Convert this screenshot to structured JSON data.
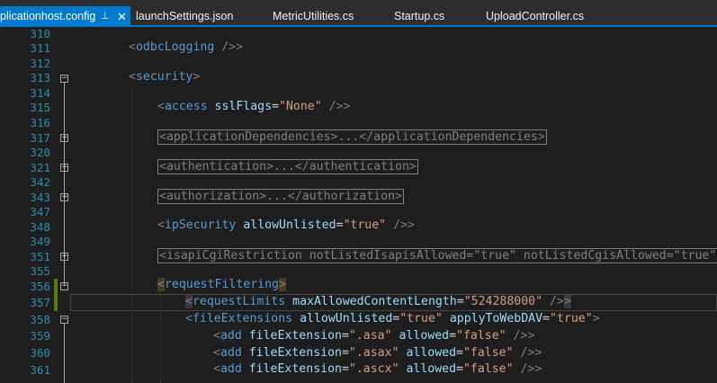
{
  "tabs": [
    {
      "label": "plicationhost.config",
      "pin": "⊥",
      "close": "✕",
      "active": true
    },
    {
      "label": "launchSettings.json"
    },
    {
      "label": "MetricUtilities.cs"
    },
    {
      "label": "Startup.cs"
    },
    {
      "label": "UploadController.cs"
    }
  ],
  "lines": [
    {
      "num": "310"
    },
    {
      "num": "311",
      "tag": "odbcLogging",
      "close": " />"
    },
    {
      "num": "312"
    },
    {
      "num": "313",
      "tag": "security",
      "fold": "−"
    },
    {
      "num": "314"
    },
    {
      "num": "315",
      "tag": "access",
      "attr1": "sslFlags",
      "val1": "\"None\"",
      "close": " />"
    },
    {
      "num": "316"
    },
    {
      "num": "317",
      "collapsed": "<applicationDependencies>...</applicationDependencies>",
      "fold": "+"
    },
    {
      "num": "320"
    },
    {
      "num": "321",
      "collapsed": "<authentication>...</authentication>",
      "fold": "+"
    },
    {
      "num": "342"
    },
    {
      "num": "343",
      "collapsed": "<authorization>...</authorization>",
      "fold": "+"
    },
    {
      "num": "347"
    },
    {
      "num": "348",
      "tag": "ipSecurity",
      "attr1": "allowUnlisted",
      "val1": "\"true\"",
      "close": " />"
    },
    {
      "num": "349"
    },
    {
      "num": "351",
      "collapsed": "<isapiCgiRestriction notListedIsapisAllowed=\"true\" notListedCgisAllowed=\"true\">",
      "fold": "+"
    },
    {
      "num": "355"
    },
    {
      "num": "356",
      "tag": "requestFiltering",
      "fold": "−"
    },
    {
      "num": "357",
      "tag": "requestLimits",
      "attr1": "maxAllowedContentLength",
      "val1": "\"524288000\"",
      "close": " />"
    },
    {
      "num": "358",
      "tag": "fileExtensions",
      "attr1": "allowUnlisted",
      "val1": "\"true\"",
      "attr2": "applyToWebDAV",
      "val2": "\"true\"",
      "fold": "−"
    },
    {
      "num": "359",
      "tag": "add",
      "attr1": "fileExtension",
      "val1": "\".asa\"",
      "attr2": "allowed",
      "val2": "\"false\"",
      "close": " />"
    },
    {
      "num": "360",
      "tag": "add",
      "attr1": "fileExtension",
      "val1": "\".asax\"",
      "attr2": "allowed",
      "val2": "\"false\"",
      "close": " />"
    },
    {
      "num": "361",
      "tag": "add",
      "attr1": "fileExtension",
      "val1": "\".ascx\"",
      "attr2": "allowed",
      "val2": "\"false\"",
      "close": " />"
    }
  ],
  "colors": {
    "accent": "#007acc",
    "tag": "#569cd6",
    "attribute": "#9cdcfe",
    "value": "#d69d85",
    "line_number": "#2b91af"
  }
}
